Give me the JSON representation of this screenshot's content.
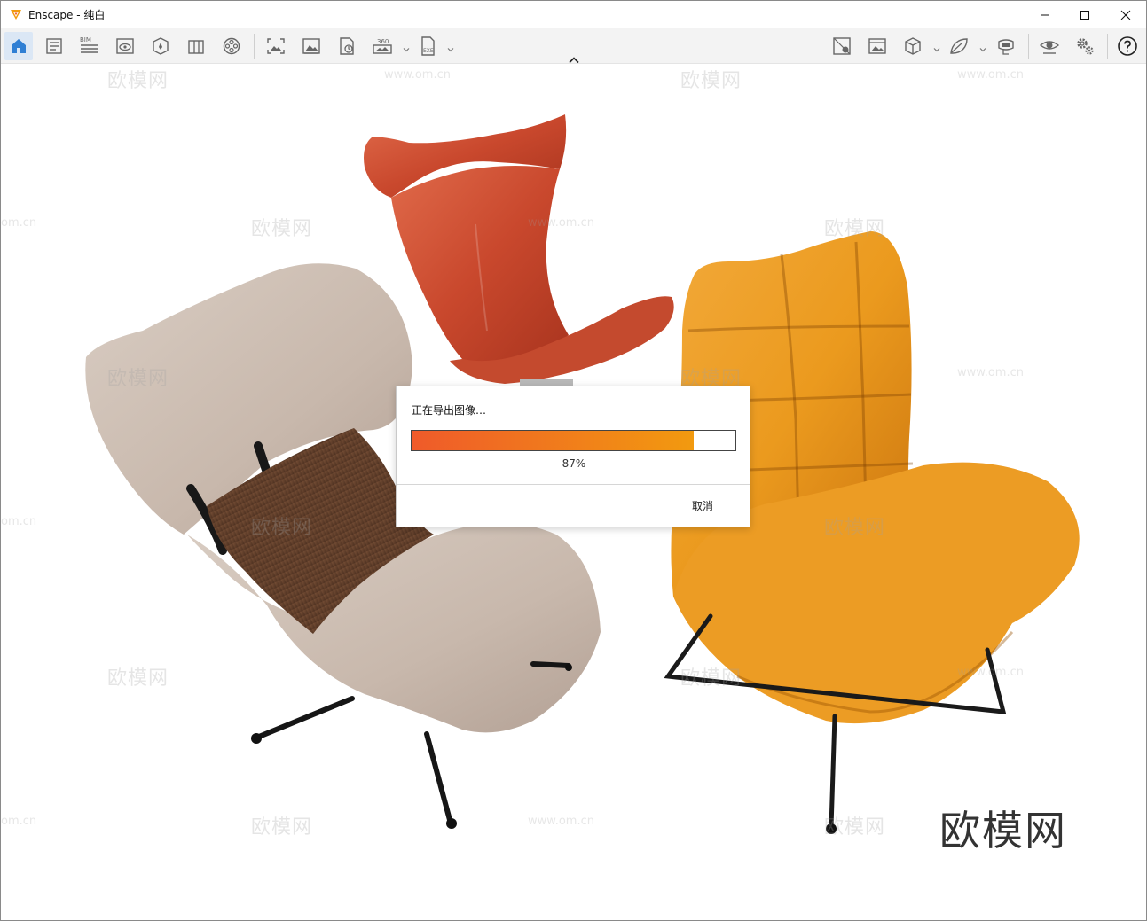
{
  "window": {
    "app_name": "Enscape",
    "title": "Enscape - 纯白",
    "accent": "#f29a0f"
  },
  "toolbar": {
    "left_icons": [
      "home-icon",
      "document-list-icon",
      "bim-icon",
      "view-icon",
      "compass-icon",
      "library-icon",
      "video-reel-icon"
    ],
    "bim_label": "BIM",
    "capture_icons": [
      "screenshot-icon",
      "image-icon",
      "batch-render-icon",
      "panorama-360-icon",
      "export-exe-icon"
    ],
    "panorama_label": "360",
    "exe_label": "EXE",
    "right_icons": [
      "material-editor-icon",
      "asset-image-icon",
      "cube-icon",
      "leaf-icon",
      "vr-headset-icon",
      "eye-icon",
      "settings-icon",
      "help-icon"
    ]
  },
  "viewport": {
    "watermark_text": "欧模网",
    "watermark_url": "www.om.cn",
    "watermark_url_partial": "om.cn",
    "brand_mark": "欧模网"
  },
  "dialog": {
    "title": "正在导出图像…",
    "progress_percent": 87,
    "progress_label": "87%",
    "cancel_label": "取消",
    "progress_colors": [
      "#ef5a2a",
      "#f29a0f"
    ]
  }
}
